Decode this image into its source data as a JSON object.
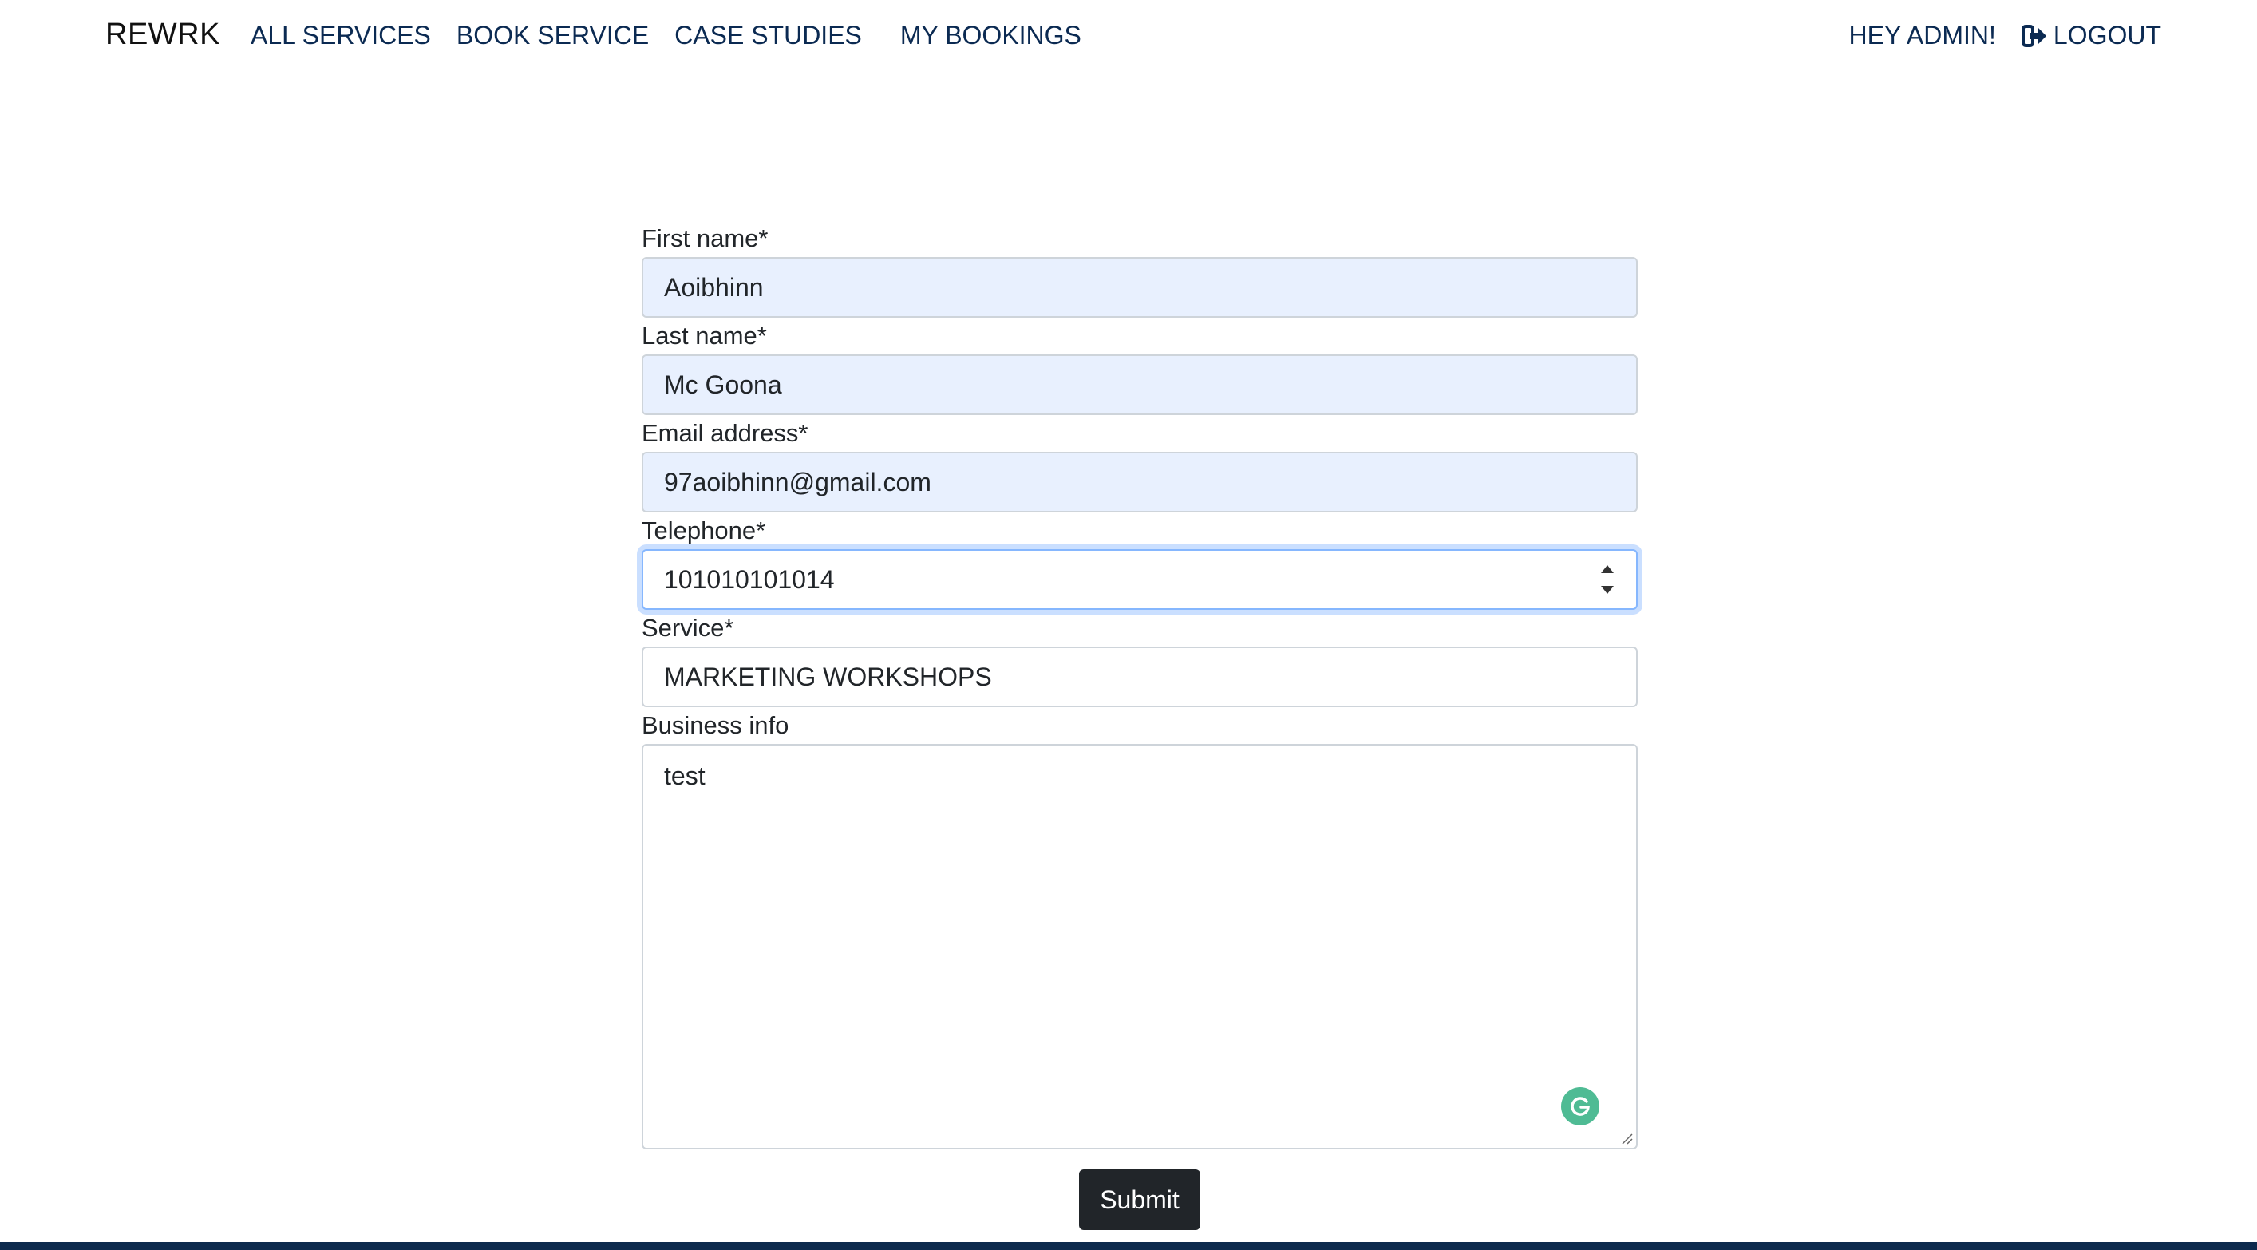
{
  "nav": {
    "brand": "REWRK",
    "links": [
      {
        "label": "ALL SERVICES"
      },
      {
        "label": "BOOK SERVICE"
      },
      {
        "label": "CASE STUDIES"
      },
      {
        "label": "MY BOOKINGS"
      }
    ],
    "greeting": "HEY ADMIN!",
    "logout": "LOGOUT"
  },
  "form": {
    "first_name": {
      "label": "First name*",
      "value": "Aoibhinn"
    },
    "last_name": {
      "label": "Last name*",
      "value": "Mc Goona"
    },
    "email": {
      "label": "Email address*",
      "value": "97aoibhinn@gmail.com"
    },
    "telephone": {
      "label": "Telephone*",
      "value": "101010101014"
    },
    "service": {
      "label": "Service*",
      "value": "MARKETING WORKSHOPS"
    },
    "business_info": {
      "label": "Business info",
      "value": "test"
    },
    "submit_label": "Submit"
  },
  "colors": {
    "nav_text": "#0b2a52",
    "autofill_bg": "#e8f0fe",
    "focus_border": "#86b7fe",
    "submit_bg": "#212529",
    "footer": "#0d2a4d",
    "grammarly": "#4fbb94"
  }
}
